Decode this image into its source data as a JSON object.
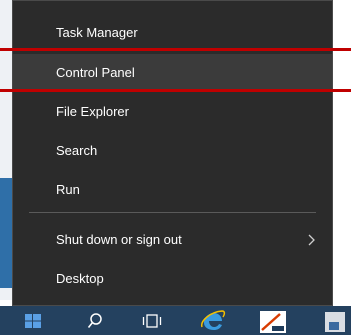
{
  "menu": {
    "items": [
      {
        "label": "Task Manager"
      },
      {
        "label": "Control Panel"
      },
      {
        "label": "File Explorer"
      },
      {
        "label": "Search"
      },
      {
        "label": "Run"
      },
      {
        "label": "Shut down or sign out"
      },
      {
        "label": "Desktop"
      }
    ]
  },
  "taskbar": {
    "icons": [
      "windows-start-icon",
      "search-icon",
      "task-view-icon",
      "internet-explorer-icon",
      "document-app-icon",
      "app-icon"
    ]
  },
  "colors": {
    "menu_bg": "#2b2b2b",
    "hover_bg": "#3b3b3b",
    "highlight": "#c00000",
    "taskbar_bg": "#24415f"
  }
}
